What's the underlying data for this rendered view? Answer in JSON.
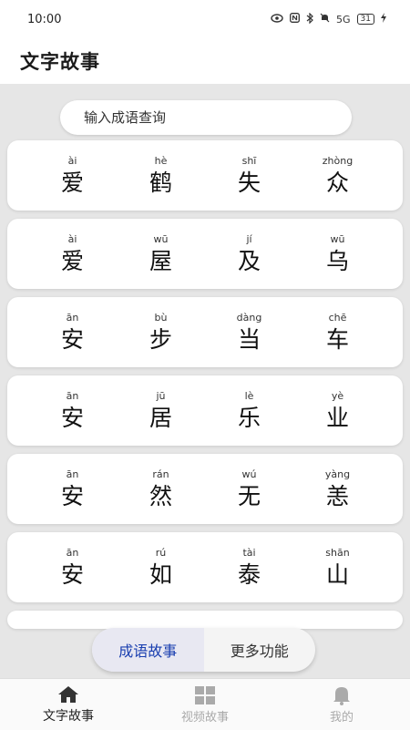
{
  "status_bar": {
    "time": "10:00",
    "network": "5G",
    "battery": "31"
  },
  "header": {
    "title": "文字故事"
  },
  "search": {
    "placeholder": "输入成语查询",
    "value": ""
  },
  "idioms": [
    {
      "chars": [
        {
          "pinyin": "ài",
          "hanzi": "爱"
        },
        {
          "pinyin": "hè",
          "hanzi": "鹤"
        },
        {
          "pinyin": "shī",
          "hanzi": "失"
        },
        {
          "pinyin": "zhòng",
          "hanzi": "众"
        }
      ]
    },
    {
      "chars": [
        {
          "pinyin": "ài",
          "hanzi": "爱"
        },
        {
          "pinyin": "wū",
          "hanzi": "屋"
        },
        {
          "pinyin": "jí",
          "hanzi": "及"
        },
        {
          "pinyin": "wū",
          "hanzi": "乌"
        }
      ]
    },
    {
      "chars": [
        {
          "pinyin": "ān",
          "hanzi": "安"
        },
        {
          "pinyin": "bù",
          "hanzi": "步"
        },
        {
          "pinyin": "dàng",
          "hanzi": "当"
        },
        {
          "pinyin": "chē",
          "hanzi": "车"
        }
      ]
    },
    {
      "chars": [
        {
          "pinyin": "ān",
          "hanzi": "安"
        },
        {
          "pinyin": "jū",
          "hanzi": "居"
        },
        {
          "pinyin": "lè",
          "hanzi": "乐"
        },
        {
          "pinyin": "yè",
          "hanzi": "业"
        }
      ]
    },
    {
      "chars": [
        {
          "pinyin": "ān",
          "hanzi": "安"
        },
        {
          "pinyin": "rán",
          "hanzi": "然"
        },
        {
          "pinyin": "wú",
          "hanzi": "无"
        },
        {
          "pinyin": "yàng",
          "hanzi": "恙"
        }
      ]
    },
    {
      "chars": [
        {
          "pinyin": "ān",
          "hanzi": "安"
        },
        {
          "pinyin": "rú",
          "hanzi": "如"
        },
        {
          "pinyin": "tài",
          "hanzi": "泰"
        },
        {
          "pinyin": "shān",
          "hanzi": "山"
        }
      ]
    }
  ],
  "segmented": {
    "active": "成语故事",
    "inactive": "更多功能",
    "active_color": "#1a3fb0"
  },
  "bottom_nav": [
    {
      "label": "文字故事",
      "icon": "home-icon",
      "active": true
    },
    {
      "label": "视频故事",
      "icon": "grid-icon",
      "active": false
    },
    {
      "label": "我的",
      "icon": "bell-icon",
      "active": false
    }
  ]
}
